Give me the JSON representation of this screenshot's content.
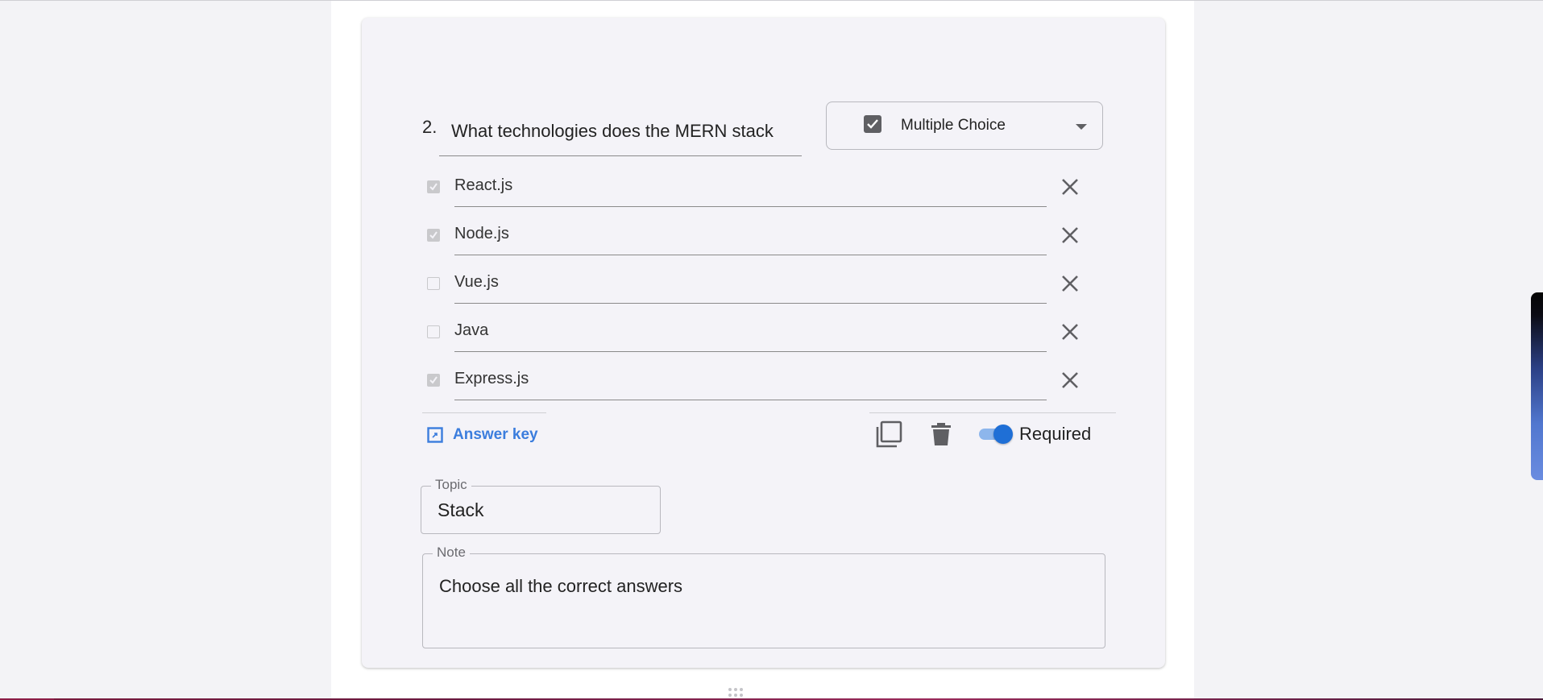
{
  "question": {
    "number": "2.",
    "text": "What technologies does the MERN stack",
    "type_label": "Multiple Choice"
  },
  "options": [
    {
      "label": "React.js",
      "checked": true
    },
    {
      "label": "Node.js",
      "checked": true
    },
    {
      "label": "Vue.js",
      "checked": false
    },
    {
      "label": "Java",
      "checked": false
    },
    {
      "label": "Express.js",
      "checked": true
    }
  ],
  "footer": {
    "answer_key_label": "Answer key",
    "required_label": "Required",
    "required_on": true
  },
  "topic": {
    "legend": "Topic",
    "value": "Stack"
  },
  "note": {
    "legend": "Note",
    "value": "Choose all the correct answers"
  },
  "colors": {
    "accent": "#1f6fd6",
    "answer_key": "#3b7ddd",
    "card_bg": "#f4f3f8"
  }
}
